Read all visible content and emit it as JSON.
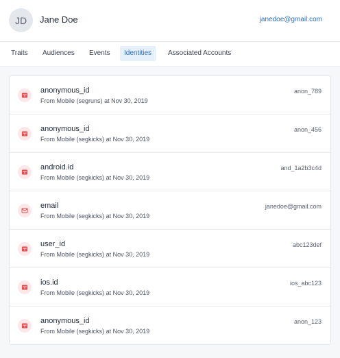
{
  "user": {
    "initials": "JD",
    "name": "Jane Doe",
    "email": "janedoe@gmail.com"
  },
  "tabs": [
    {
      "label": "Traits"
    },
    {
      "label": "Audiences"
    },
    {
      "label": "Events"
    },
    {
      "label": "Identities",
      "active": true
    },
    {
      "label": "Associated Accounts"
    }
  ],
  "identities": [
    {
      "type": "anonymous_id",
      "source_prefix": "From",
      "source": "Mobile (segruns)",
      "at": "at",
      "date": "Nov 30, 2019",
      "value": "anon_789",
      "icon": "device-icon"
    },
    {
      "type": "anonymous_id",
      "source_prefix": "From",
      "source": "Mobile (segkicks)",
      "at": "at",
      "date": "Nov 30, 2019",
      "value": "anon_456",
      "icon": "device-icon"
    },
    {
      "type": "android.id",
      "source_prefix": "From",
      "source": "Mobile (segkicks)",
      "at": "at",
      "date": "Nov 30, 2019",
      "value": "and_1a2b3c4d",
      "icon": "device-icon"
    },
    {
      "type": "email",
      "source_prefix": "From",
      "source": "Mobile (segkicks)",
      "at": "at",
      "date": "Nov 30, 2019",
      "value": "janedoe@gmail.com",
      "icon": "mail-icon"
    },
    {
      "type": "user_id",
      "source_prefix": "From",
      "source": "Mobile (segkicks)",
      "at": "at",
      "date": "Nov 30, 2019",
      "value": "abc123def",
      "icon": "device-icon"
    },
    {
      "type": "ios.id",
      "source_prefix": "From",
      "source": "Mobile (segkicks)",
      "at": "at",
      "date": "Nov 30, 2019",
      "value": "ios_abc123",
      "icon": "device-icon"
    },
    {
      "type": "anonymous_id",
      "source_prefix": "From",
      "source": "Mobile (segkicks)",
      "at": "at",
      "date": "Nov 30, 2019",
      "value": "anon_123",
      "icon": "device-icon"
    }
  ],
  "colors": {
    "accent": "#2b6cc4",
    "active_tab_bg": "#e6f0fb",
    "icon_bg": "#fde8e8",
    "icon_fg": "#e5484d"
  }
}
